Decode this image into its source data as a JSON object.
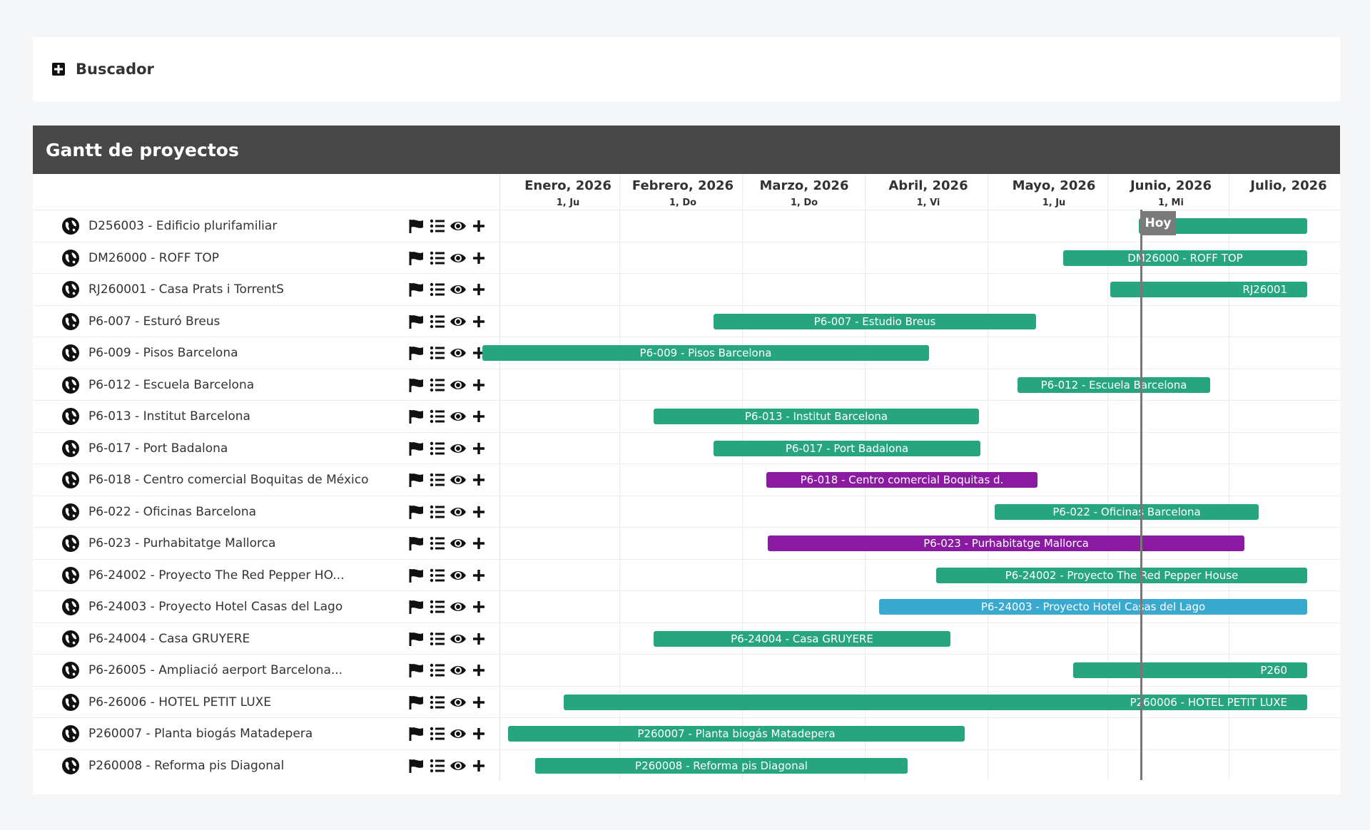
{
  "search": {
    "title": "Buscador",
    "icon": "expand-square-icon"
  },
  "gantt": {
    "title": "Gantt de proyectos",
    "today_label": "Hoy",
    "months": [
      {
        "name": "Enero, 2026",
        "sub": "1, Ju"
      },
      {
        "name": "Febrero, 2026",
        "sub": "1, Do"
      },
      {
        "name": "Marzo, 2026",
        "sub": "1, Do"
      },
      {
        "name": "Abril, 2026",
        "sub": "1, Vi"
      },
      {
        "name": "Mayo, 2026",
        "sub": "1, Ju"
      },
      {
        "name": "Junio, 2026",
        "sub": "1, Mi"
      },
      {
        "name": "Julio, 2026",
        "sub": ""
      }
    ],
    "row_icons": [
      "flag-icon",
      "list-icon",
      "eye-icon",
      "plus-icon"
    ],
    "colors": {
      "green": "#27a57e",
      "purple": "#8b1aa3",
      "blue": "#3aa9d0",
      "dark_green": "#1f8f69"
    },
    "rows": [
      {
        "label": "D256003 - Edificio plurifamiliar",
        "bar": ""
      },
      {
        "label": "DM26000 - ROFF TOP",
        "bar": "DM26000 - ROFF TOP"
      },
      {
        "label": "RJ260001 - Casa Prats i TorrentS",
        "bar": "RJ26001"
      },
      {
        "label": "P6-007 - Esturó Breus",
        "bar": "P6-007 - Estudio Breus"
      },
      {
        "label": "P6-009 - Pisos Barcelona",
        "bar": "P6-009 - Pisos Barcelona"
      },
      {
        "label": "P6-012 - Escuela Barcelona",
        "bar": "P6-012 - Escuela Barcelona"
      },
      {
        "label": "P6-013 - Institut Barcelona",
        "bar": "P6-013 - Institut Barcelona"
      },
      {
        "label": "P6-017 - Port Badalona",
        "bar": "P6-017 - Port Badalona"
      },
      {
        "label": "P6-018 - Centro comercial Boquitas de México",
        "bar": "P6-018 - Centro comercial Boquitas d."
      },
      {
        "label": "P6-022 - Oficinas Barcelona",
        "bar": "P6-022 - Oficinas Barcelona"
      },
      {
        "label": "P6-023 - Purhabitatge Mallorca",
        "bar": "P6-023 - Purhabitatge Mallorca"
      },
      {
        "label": "P6-24002 - Proyecto The Red Pepper HO...",
        "bar": "P6-24002 - Proyecto The Red Pepper House"
      },
      {
        "label": "P6-24003 - Proyecto Hotel Casas del Lago",
        "bar": "P6-24003 - Proyecto Hotel Casas del Lago"
      },
      {
        "label": "P6-24004 - Casa GRUYERE",
        "bar": "P6-24004 - Casa GRUYERE"
      },
      {
        "label": "P6-26005 - Ampliació aerport Barcelona...",
        "bar": "P260"
      },
      {
        "label": "P6-26006 - HOTEL PETIT LUXE",
        "bar": "P260006 - HOTEL PETIT LUXE"
      },
      {
        "label": "P260007 - Planta biogás Matadepera",
        "bar": "P260007 - Planta biogás Matadepera"
      },
      {
        "label": "P260008 - Reforma pis Diagonal",
        "bar": "P260008 - Reforma pis Diagonal"
      }
    ]
  }
}
